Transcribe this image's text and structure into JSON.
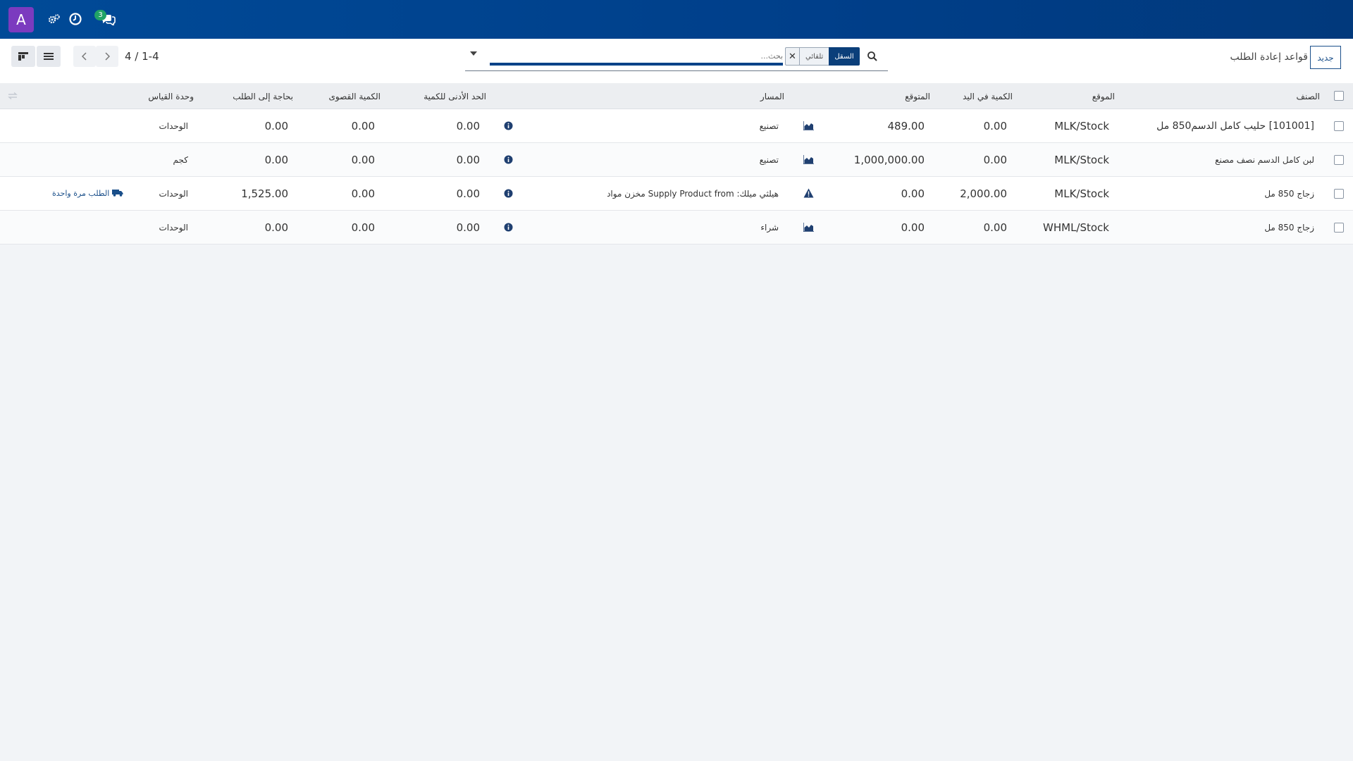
{
  "navbar": {
    "avatar_letter": "A",
    "messages_badge": "3",
    "icons": [
      "settings-icon",
      "clock-icon",
      "chat-icon"
    ]
  },
  "control_panel": {
    "pager": "4 / 1-4",
    "search": {
      "placeholder": "بحث...",
      "facet_label": "السقل",
      "facet_value": "تلقائي"
    },
    "title": "قواعد إعادة الطلب",
    "new_button": "جديد"
  },
  "table": {
    "headers": {
      "product": "الصنف",
      "location": "الموقع",
      "on_hand": "الكمية في اليد",
      "forecast": "المتوقع",
      "route": "المسار",
      "min_qty": "الحد الأدنى للكمية",
      "max_qty": "الكمية القصوى",
      "to_order": "بحاجة إلى الطلب",
      "uom": "وحدة القياس"
    },
    "rows": [
      {
        "product": "[101001] حليب كامل الدسم850 مل",
        "location": "MLK/Stock",
        "on_hand": "0.00",
        "forecast": "489.00",
        "route": "تصنيع",
        "min_qty": "0.00",
        "max_qty": "0.00",
        "to_order": "0.00",
        "uom": "الوحدات",
        "order_once": ""
      },
      {
        "product": "لبن كامل الدسم نصف مصنع",
        "location": "MLK/Stock",
        "on_hand": "0.00",
        "forecast": "1,000,000.00",
        "route": "تصنيع",
        "min_qty": "0.00",
        "max_qty": "0.00",
        "to_order": "0.00",
        "uom": "كجم",
        "order_once": ""
      },
      {
        "product": "زجاج 850 مل",
        "location": "MLK/Stock",
        "on_hand": "2,000.00",
        "forecast": "0.00",
        "route": "هيلثي ميلك: Supply Product from مخزن مواد",
        "min_qty": "0.00",
        "max_qty": "0.00",
        "to_order": "1,525.00",
        "uom": "الوحدات",
        "order_once": "الطلب مرة واحدة"
      },
      {
        "product": "زجاج 850 مل",
        "location": "WHML/Stock",
        "on_hand": "0.00",
        "forecast": "0.00",
        "route": "شراء",
        "min_qty": "0.00",
        "max_qty": "0.00",
        "to_order": "0.00",
        "uom": "الوحدات",
        "order_once": ""
      }
    ]
  },
  "colors": {
    "navbar": "#004a97",
    "accent": "#014288",
    "avatar": "#7b3bbf",
    "badge": "#21a366"
  }
}
